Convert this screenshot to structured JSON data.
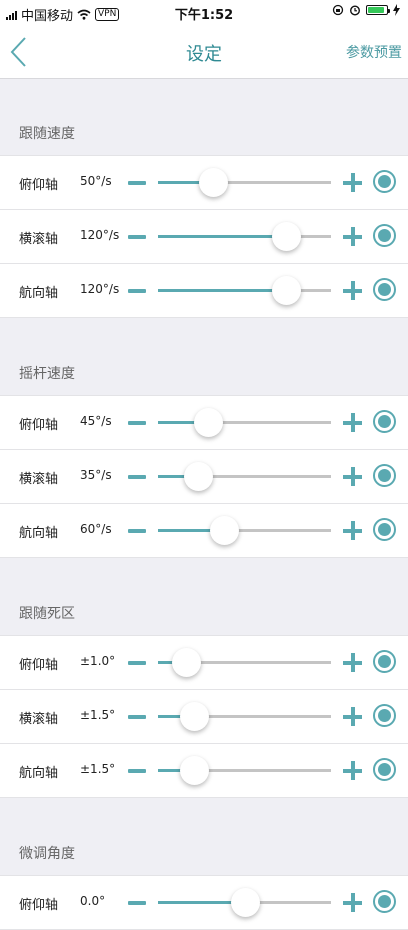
{
  "status_bar": {
    "carrier": "中国移动",
    "vpn": "VPN",
    "time": "下午1:52",
    "battery_level": 0.9
  },
  "navbar": {
    "title": "设定",
    "right_action": "参数预置"
  },
  "sections": [
    {
      "title": "跟随速度",
      "rows": [
        {
          "label": "俯仰轴",
          "value": "50°/s",
          "slider_fraction": 0.32
        },
        {
          "label": "横滚轴",
          "value": "120°/s",
          "slider_fraction": 0.74
        },
        {
          "label": "航向轴",
          "value": "120°/s",
          "slider_fraction": 0.74
        }
      ]
    },
    {
      "title": "摇杆速度",
      "rows": [
        {
          "label": "俯仰轴",
          "value": "45°/s",
          "slider_fraction": 0.29
        },
        {
          "label": "横滚轴",
          "value": "35°/s",
          "slider_fraction": 0.23
        },
        {
          "label": "航向轴",
          "value": "60°/s",
          "slider_fraction": 0.38
        }
      ]
    },
    {
      "title": "跟随死区",
      "rows": [
        {
          "label": "俯仰轴",
          "value": "±1.0°",
          "slider_fraction": 0.16
        },
        {
          "label": "横滚轴",
          "value": "±1.5°",
          "slider_fraction": 0.21
        },
        {
          "label": "航向轴",
          "value": "±1.5°",
          "slider_fraction": 0.21
        }
      ]
    },
    {
      "title": "微调角度",
      "rows": [
        {
          "label": "俯仰轴",
          "value": "0.0°",
          "slider_fraction": 0.5
        }
      ]
    }
  ],
  "colors": {
    "accent": "#5aa9b1",
    "title": "#2f8a93",
    "background": "#efeff4",
    "track": "#c4c4c4"
  }
}
